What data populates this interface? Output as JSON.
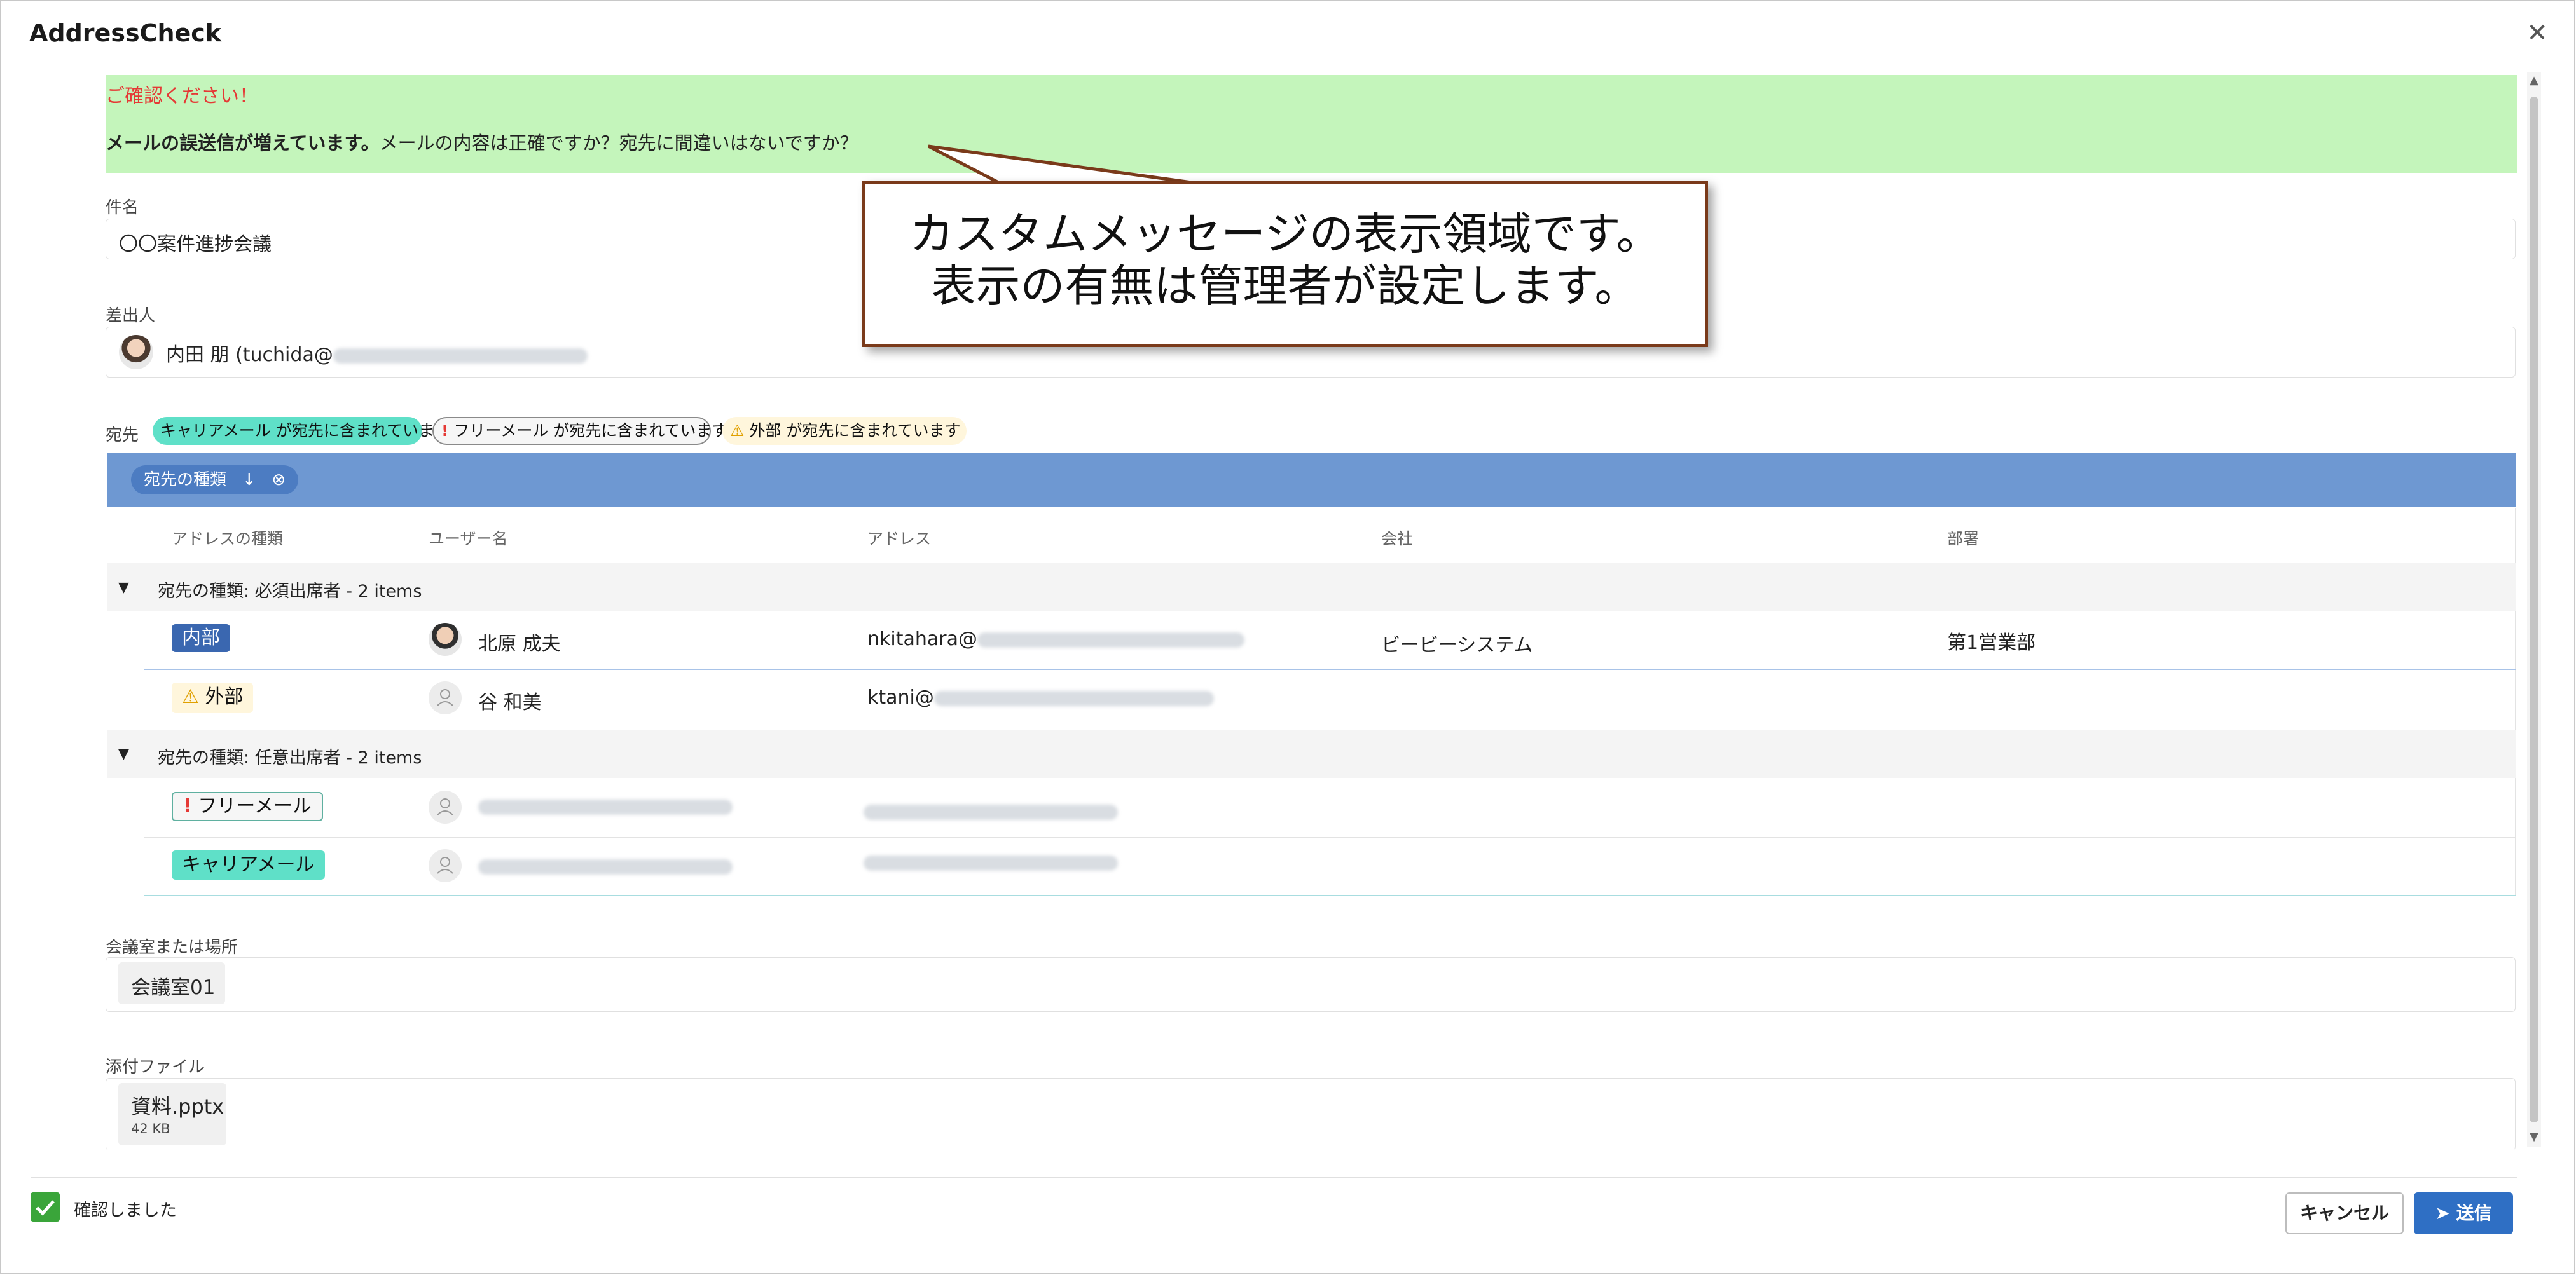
{
  "app": {
    "title": "AddressCheck"
  },
  "banner": {
    "warning": "ご確認ください！",
    "bold": "メールの誤送信が増えています。",
    "message": "メールの内容は正確ですか？宛先に間違いはないですか？"
  },
  "subject": {
    "label": "件名",
    "value": "〇〇案件進捗会議"
  },
  "sender": {
    "label": "差出人",
    "value": "内田 朋 (tuchida@"
  },
  "recipients": {
    "label": "宛先",
    "badges": [
      {
        "text": "キャリアメール が宛先に含まれています",
        "color": "#5fe0c8"
      },
      {
        "text": "フリーメール が宛先に含まれています",
        "color": "#f6f6f6"
      },
      {
        "text": "外部 が宛先に含まれています",
        "color": "#fff6dc"
      }
    ],
    "groupby_chip": "宛先の種類",
    "columns": [
      "アドレスの種類",
      "ユーザー名",
      "アドレス",
      "会社",
      "部署"
    ],
    "groups": [
      {
        "title": "宛先の種類: 必須出席者 - 2 items",
        "rows": [
          {
            "type": "内部",
            "name": "北原 成夫",
            "address": "nkitahara@",
            "company": "ビービーシステム",
            "dept": "第1営業部"
          },
          {
            "type": "外部",
            "name": "谷 和美",
            "address": "ktani@",
            "company": "",
            "dept": ""
          }
        ]
      },
      {
        "title": "宛先の種類: 任意出席者 - 2 items",
        "rows": [
          {
            "type": "フリーメール",
            "name": "",
            "address": "",
            "company": "",
            "dept": ""
          },
          {
            "type": "キャリアメール",
            "name": "",
            "address": "",
            "company": "",
            "dept": ""
          }
        ]
      }
    ]
  },
  "location": {
    "label": "会議室または場所",
    "value": "会議室01"
  },
  "attachments": {
    "label": "添付ファイル",
    "name": "資料.pptx",
    "size": "42 KB"
  },
  "footer": {
    "confirm_label": "確認しました",
    "cancel": "キャンセル",
    "send": "送信"
  },
  "callout": {
    "line1": "カスタムメッセージの表示領域です。",
    "line2": "表示の有無は管理者が設定します。"
  },
  "colors": {
    "banner": "#c4f5bb",
    "groupbar": "#6e98d2",
    "internal": "#3a67b0",
    "carrier": "#5fe0c8",
    "send": "#2f6fc4",
    "check": "#3aa53a"
  }
}
